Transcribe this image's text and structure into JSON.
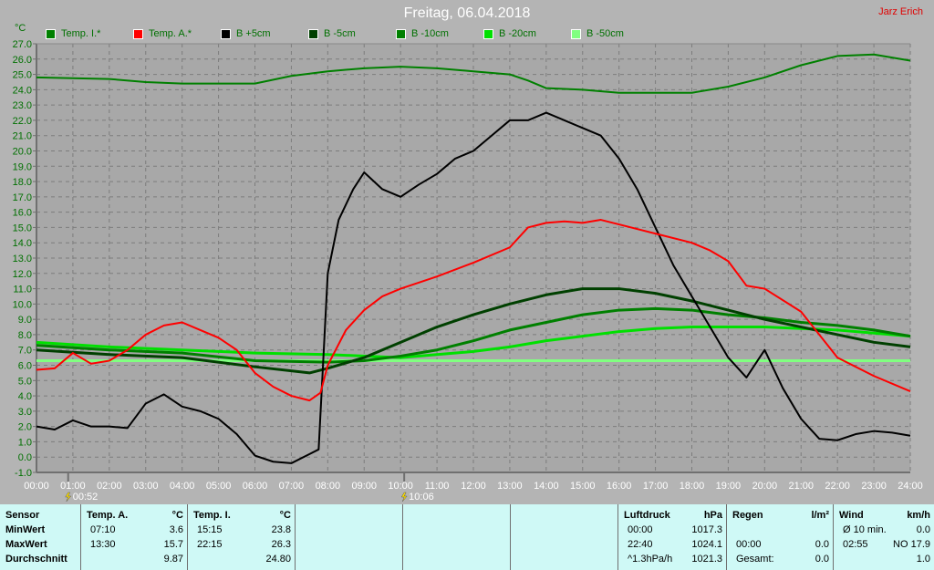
{
  "header": {
    "title": "Freitag, 06.04.2018",
    "author": "Jarz Erich"
  },
  "chart_data": {
    "type": "line",
    "ylabel": "°C",
    "ylim": [
      -1,
      27
    ],
    "xlim": [
      0,
      24
    ],
    "grid": true,
    "y_ticks": [
      "-1.0",
      "0.0",
      "1.0",
      "2.0",
      "3.0",
      "4.0",
      "5.0",
      "6.0",
      "7.0",
      "8.0",
      "9.0",
      "10.0",
      "11.0",
      "12.0",
      "13.0",
      "14.0",
      "15.0",
      "16.0",
      "17.0",
      "18.0",
      "19.0",
      "20.0",
      "21.0",
      "22.0",
      "23.0",
      "24.0",
      "25.0",
      "26.0",
      "27.0"
    ],
    "x_ticks": [
      "00:00",
      "01:00",
      "02:00",
      "03:00",
      "04:00",
      "05:00",
      "06:00",
      "07:00",
      "08:00",
      "09:00",
      "10:00",
      "11:00",
      "12:00",
      "13:00",
      "14:00",
      "15:00",
      "16:00",
      "17:00",
      "18:00",
      "19:00",
      "20:00",
      "21:00",
      "22:00",
      "23:00",
      "24:00"
    ],
    "markers": [
      {
        "label": "00:52",
        "hour": 0.87
      },
      {
        "label": "10:06",
        "hour": 10.1
      }
    ],
    "series": [
      {
        "name": "Temp. I.*",
        "color": "#008000",
        "width": 2,
        "points": [
          [
            0,
            24.8
          ],
          [
            2,
            24.7
          ],
          [
            3,
            24.5
          ],
          [
            4,
            24.4
          ],
          [
            6,
            24.4
          ],
          [
            7,
            24.9
          ],
          [
            8,
            25.2
          ],
          [
            9,
            25.4
          ],
          [
            10,
            25.5
          ],
          [
            11,
            25.4
          ],
          [
            12,
            25.2
          ],
          [
            13,
            25.0
          ],
          [
            13.5,
            24.6
          ],
          [
            14,
            24.1
          ],
          [
            15,
            24.0
          ],
          [
            16,
            23.8
          ],
          [
            17,
            23.8
          ],
          [
            18,
            23.8
          ],
          [
            19,
            24.2
          ],
          [
            20,
            24.8
          ],
          [
            21,
            25.6
          ],
          [
            22,
            26.2
          ],
          [
            23,
            26.3
          ],
          [
            24,
            25.9
          ]
        ]
      },
      {
        "name": "Temp. A.*",
        "color": "#ff0000",
        "width": 2,
        "points": [
          [
            0,
            5.7
          ],
          [
            0.5,
            5.8
          ],
          [
            1,
            6.8
          ],
          [
            1.5,
            6.1
          ],
          [
            2,
            6.3
          ],
          [
            2.5,
            7.0
          ],
          [
            3,
            8.0
          ],
          [
            3.5,
            8.6
          ],
          [
            4,
            8.8
          ],
          [
            4.5,
            8.3
          ],
          [
            5,
            7.8
          ],
          [
            5.5,
            7.0
          ],
          [
            6,
            5.5
          ],
          [
            6.5,
            4.6
          ],
          [
            7,
            4.0
          ],
          [
            7.5,
            3.7
          ],
          [
            7.8,
            4.2
          ],
          [
            8,
            6.0
          ],
          [
            8.5,
            8.3
          ],
          [
            9,
            9.6
          ],
          [
            9.5,
            10.5
          ],
          [
            10,
            11.0
          ],
          [
            11,
            11.8
          ],
          [
            12,
            12.7
          ],
          [
            13,
            13.7
          ],
          [
            13.5,
            15.0
          ],
          [
            14,
            15.3
          ],
          [
            14.5,
            15.4
          ],
          [
            15,
            15.3
          ],
          [
            15.5,
            15.5
          ],
          [
            16,
            15.2
          ],
          [
            17,
            14.6
          ],
          [
            18,
            14.0
          ],
          [
            18.5,
            13.5
          ],
          [
            19,
            12.8
          ],
          [
            19.5,
            11.2
          ],
          [
            20,
            11.0
          ],
          [
            21,
            9.5
          ],
          [
            22,
            6.5
          ],
          [
            23,
            5.3
          ],
          [
            24,
            4.3
          ]
        ]
      },
      {
        "name": "B +5cm",
        "color": "#000000",
        "width": 2,
        "points": [
          [
            0,
            2.0
          ],
          [
            0.5,
            1.8
          ],
          [
            1,
            2.4
          ],
          [
            1.5,
            2.0
          ],
          [
            2,
            2.0
          ],
          [
            2.5,
            1.9
          ],
          [
            3,
            3.5
          ],
          [
            3.5,
            4.1
          ],
          [
            4,
            3.3
          ],
          [
            4.5,
            3.0
          ],
          [
            5,
            2.5
          ],
          [
            5.5,
            1.5
          ],
          [
            6,
            0.1
          ],
          [
            6.5,
            -0.3
          ],
          [
            7,
            -0.4
          ],
          [
            7.5,
            0.2
          ],
          [
            7.75,
            0.5
          ],
          [
            8,
            12.0
          ],
          [
            8.3,
            15.5
          ],
          [
            8.7,
            17.5
          ],
          [
            9,
            18.6
          ],
          [
            9.5,
            17.5
          ],
          [
            10,
            17.0
          ],
          [
            10.5,
            17.8
          ],
          [
            11,
            18.5
          ],
          [
            11.5,
            19.5
          ],
          [
            12,
            20.0
          ],
          [
            12.5,
            21.0
          ],
          [
            13,
            22.0
          ],
          [
            13.5,
            22.0
          ],
          [
            14,
            22.5
          ],
          [
            14.5,
            22.0
          ],
          [
            15,
            21.5
          ],
          [
            15.5,
            21.0
          ],
          [
            16,
            19.5
          ],
          [
            16.5,
            17.5
          ],
          [
            17,
            15.0
          ],
          [
            17.5,
            12.5
          ],
          [
            18,
            10.5
          ],
          [
            18.5,
            8.5
          ],
          [
            19,
            6.5
          ],
          [
            19.5,
            5.2
          ],
          [
            20,
            7.0
          ],
          [
            20.5,
            4.5
          ],
          [
            21,
            2.5
          ],
          [
            21.5,
            1.2
          ],
          [
            22,
            1.1
          ],
          [
            22.5,
            1.5
          ],
          [
            23,
            1.7
          ],
          [
            23.5,
            1.6
          ],
          [
            24,
            1.4
          ]
        ]
      },
      {
        "name": "B -5cm",
        "color": "#004000",
        "width": 3,
        "points": [
          [
            0,
            7.0
          ],
          [
            2,
            6.7
          ],
          [
            4,
            6.5
          ],
          [
            6,
            5.9
          ],
          [
            7.5,
            5.5
          ],
          [
            8,
            5.8
          ],
          [
            9,
            6.5
          ],
          [
            10,
            7.5
          ],
          [
            11,
            8.5
          ],
          [
            12,
            9.3
          ],
          [
            13,
            10.0
          ],
          [
            14,
            10.6
          ],
          [
            15,
            11.0
          ],
          [
            16,
            11.0
          ],
          [
            17,
            10.7
          ],
          [
            18,
            10.2
          ],
          [
            19,
            9.6
          ],
          [
            20,
            9.0
          ],
          [
            21,
            8.5
          ],
          [
            22,
            8.0
          ],
          [
            23,
            7.5
          ],
          [
            24,
            7.2
          ]
        ]
      },
      {
        "name": "B -10cm",
        "color": "#008000",
        "width": 3,
        "points": [
          [
            0,
            7.3
          ],
          [
            2,
            7.0
          ],
          [
            4,
            6.8
          ],
          [
            6,
            6.3
          ],
          [
            8,
            6.2
          ],
          [
            9,
            6.3
          ],
          [
            10,
            6.6
          ],
          [
            11,
            7.0
          ],
          [
            12,
            7.6
          ],
          [
            13,
            8.3
          ],
          [
            14,
            8.8
          ],
          [
            15,
            9.3
          ],
          [
            16,
            9.6
          ],
          [
            17,
            9.7
          ],
          [
            18,
            9.6
          ],
          [
            19,
            9.3
          ],
          [
            20,
            9.1
          ],
          [
            21,
            8.8
          ],
          [
            22,
            8.6
          ],
          [
            23,
            8.3
          ],
          [
            24,
            7.9
          ]
        ]
      },
      {
        "name": "B -20cm",
        "color": "#00e000",
        "width": 3,
        "points": [
          [
            0,
            7.5
          ],
          [
            2,
            7.2
          ],
          [
            4,
            7.0
          ],
          [
            6,
            6.8
          ],
          [
            8,
            6.7
          ],
          [
            10,
            6.5
          ],
          [
            11,
            6.7
          ],
          [
            12,
            6.9
          ],
          [
            13,
            7.2
          ],
          [
            14,
            7.6
          ],
          [
            15,
            7.9
          ],
          [
            16,
            8.2
          ],
          [
            17,
            8.4
          ],
          [
            18,
            8.5
          ],
          [
            20,
            8.5
          ],
          [
            22,
            8.3
          ],
          [
            23,
            8.1
          ],
          [
            24,
            7.9
          ]
        ]
      },
      {
        "name": "B -50cm",
        "color": "#80ff80",
        "width": 3,
        "points": [
          [
            0,
            6.3
          ],
          [
            4,
            6.3
          ],
          [
            8,
            6.3
          ],
          [
            12,
            6.3
          ],
          [
            16,
            6.3
          ],
          [
            20,
            6.3
          ],
          [
            24,
            6.3
          ]
        ]
      }
    ]
  },
  "footer": {
    "sensor": {
      "label": "Sensor",
      "rows": [
        "MinWert",
        "MaxWert",
        "Durchschnitt"
      ]
    },
    "temp_a": {
      "label": "Temp. A.",
      "unit": "°C",
      "rows": [
        [
          "07:10",
          "3.6"
        ],
        [
          "13:30",
          "15.7"
        ],
        [
          "",
          "9.87"
        ]
      ]
    },
    "temp_i": {
      "label": "Temp. I.",
      "unit": "°C",
      "rows": [
        [
          "15:15",
          "23.8"
        ],
        [
          "22:15",
          "26.3"
        ],
        [
          "",
          "24.80"
        ]
      ]
    },
    "pressure": {
      "label": "Luftdruck",
      "unit": "hPa",
      "rows": [
        [
          "00:00",
          "1017.3"
        ],
        [
          "22:40",
          "1024.1"
        ],
        [
          "^1.3hPa/h",
          "1021.3"
        ]
      ]
    },
    "rain": {
      "label": "Regen",
      "unit": "l/m²",
      "rows": [
        [
          "",
          ""
        ],
        [
          "00:00",
          "0.0"
        ],
        [
          "Gesamt:",
          "0.0"
        ]
      ]
    },
    "wind": {
      "label": "Wind",
      "unit": "km/h",
      "rows": [
        [
          "Ø 10 min.",
          "0.0"
        ],
        [
          "02:55",
          "NO 17.9"
        ],
        [
          "",
          "1.0"
        ]
      ]
    }
  }
}
